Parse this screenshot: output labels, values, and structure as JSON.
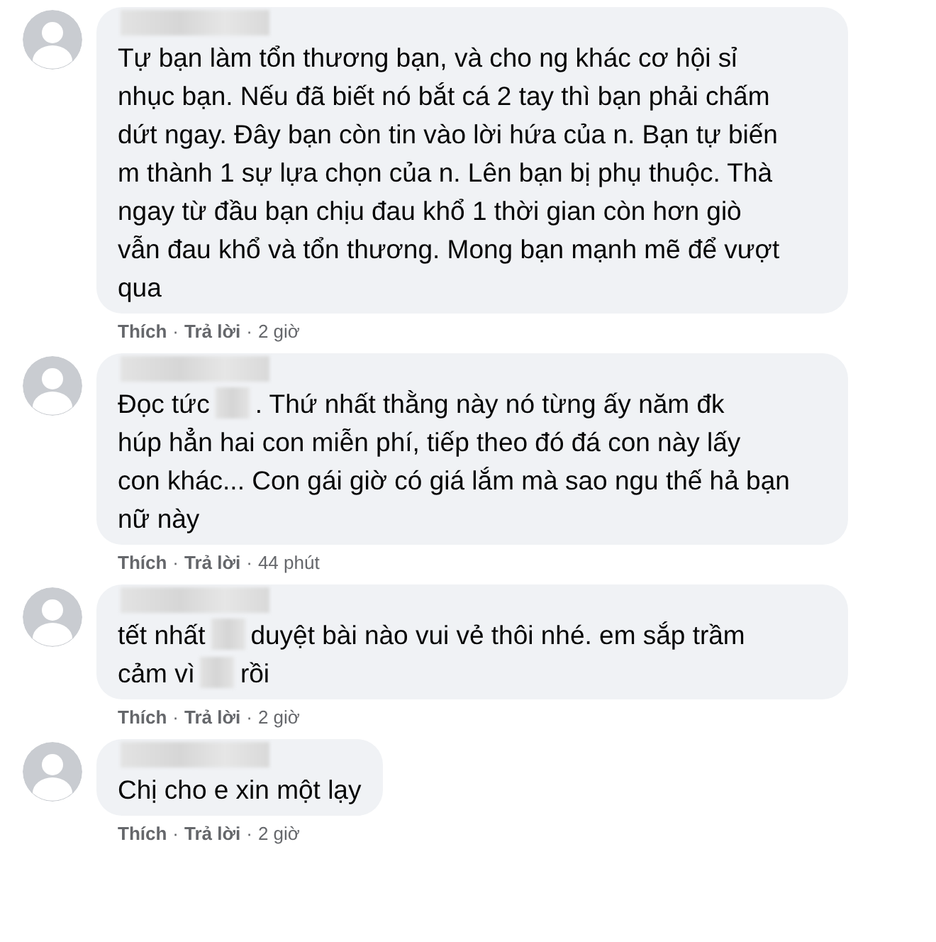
{
  "comments": [
    {
      "lines": [
        [
          {
            "kind": "text",
            "text": "Tự bạn làm tổn thương bạn, và cho ng khác cơ hội sỉ"
          }
        ],
        [
          {
            "kind": "text",
            "text": "nhục bạn. Nếu đã biết nó bắt cá 2 tay thì bạn phải chấm"
          }
        ],
        [
          {
            "kind": "text",
            "text": "dứt ngay. Đây bạn còn tin vào lời hứa của n. Bạn tự biến"
          }
        ],
        [
          {
            "kind": "text",
            "text": "m thành 1 sự lựa chọn của n. Lên bạn bị phụ thuộc. Thà"
          }
        ],
        [
          {
            "kind": "text",
            "text": "ngay từ đầu bạn chịu đau khổ 1 thời gian còn hơn giò"
          }
        ],
        [
          {
            "kind": "text",
            "text": "vẫn đau khổ và tổn thương. Mong bạn mạnh mẽ để vượt"
          }
        ],
        [
          {
            "kind": "text",
            "text": "qua"
          }
        ]
      ],
      "like": "Thích",
      "separators": [
        "·",
        "·"
      ],
      "reply": "Trả lời",
      "time": "2 giờ"
    },
    {
      "lines": [
        [
          {
            "kind": "text",
            "text": "Đọc tức"
          },
          {
            "kind": "redacted"
          },
          {
            "kind": "text",
            "text": ". Thứ nhất thằng này nó từng ấy năm đk"
          }
        ],
        [
          {
            "kind": "text",
            "text": "húp hẳn hai con miễn phí, tiếp theo đó đá con này lấy"
          }
        ],
        [
          {
            "kind": "text",
            "text": "con khác... Con gái giờ có giá lắm mà sao ngu thế hả bạn"
          }
        ],
        [
          {
            "kind": "text",
            "text": "nữ này"
          }
        ]
      ],
      "like": "Thích",
      "separators": [
        "·",
        "·"
      ],
      "reply": "Trả lời",
      "time": "44 phút"
    },
    {
      "lines": [
        [
          {
            "kind": "text",
            "text": "tết nhất"
          },
          {
            "kind": "redacted"
          },
          {
            "kind": "text",
            "text": "duyệt bài nào vui vẻ thôi nhé. em sắp trầm"
          }
        ],
        [
          {
            "kind": "text",
            "text": "cảm vì"
          },
          {
            "kind": "redacted"
          },
          {
            "kind": "text",
            "text": "rồi"
          }
        ]
      ],
      "like": "Thích",
      "separators": [
        "·",
        "·"
      ],
      "reply": "Trả lời",
      "time": "2 giờ"
    },
    {
      "lines": [
        [
          {
            "kind": "text",
            "text": "Chị cho e xin một lạy"
          }
        ]
      ],
      "like": "Thích",
      "separators": [
        "·",
        "·"
      ],
      "reply": "Trả lời",
      "time": "2 giờ"
    }
  ]
}
